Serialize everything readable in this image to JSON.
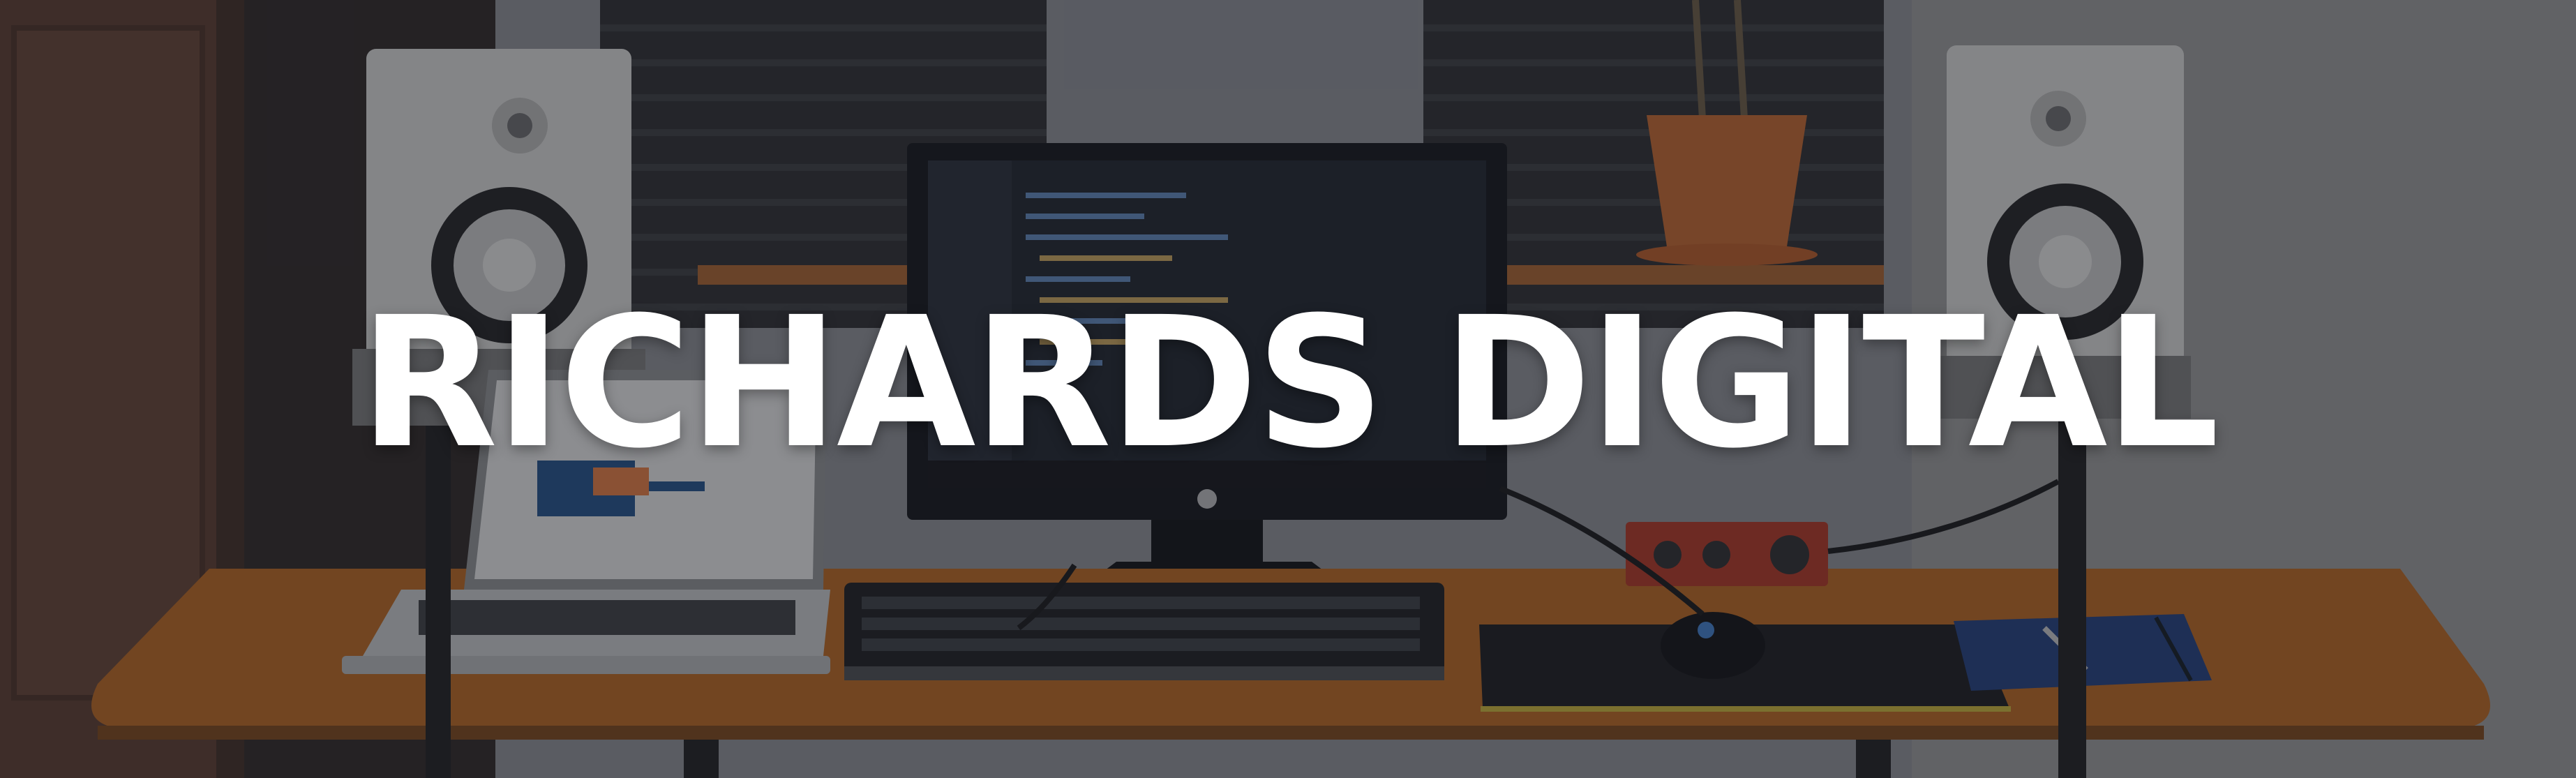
{
  "banner": {
    "title": "RICHARDS DIGITAL",
    "scene_description_icons": [
      "studio-monitor-speaker",
      "desktop-monitor",
      "laptop",
      "keyboard",
      "mouse",
      "mousepad",
      "audio-interface",
      "notebook",
      "potted-plant",
      "acoustic-foam-panel",
      "desk"
    ],
    "colors": {
      "overlay": "#1c1e28",
      "title": "#ffffff",
      "desk": "#b8651c",
      "wall": "#8d8f93"
    }
  }
}
